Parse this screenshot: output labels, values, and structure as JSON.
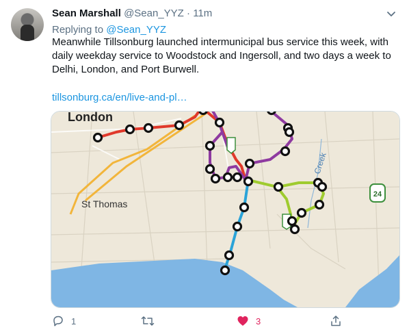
{
  "tweet": {
    "author_name": "Sean Marshall",
    "handle": "@Sean_YYZ",
    "separator": "·",
    "time": "11m",
    "reply_prefix": "Replying to ",
    "reply_handle": "@Sean_YYZ",
    "body": "Meanwhile Tillsonburg launched intermunicipal bus service this week, with daily weekday service to Woodstock and Ingersoll, and two days a week to Delhi, London, and Port Burwell.",
    "link_text": "tillsonburg.ca/en/live-and-pl…"
  },
  "map": {
    "labels": {
      "london": "London",
      "st_thomas": "St Thomas",
      "creek": "Creek",
      "hwy24": "24"
    },
    "route_colors": {
      "red": "#e0392b",
      "purple": "#8e3aa0",
      "blue": "#2aa3d8",
      "green": "#9fcb2f",
      "highway": "#f2b53b",
      "water": "#7fb6e4",
      "land": "#efe9dc"
    }
  },
  "actions": {
    "reply_count": "1",
    "retweet_count": "",
    "like_count": "3",
    "like_liked": true,
    "icons": [
      "reply-icon",
      "retweet-icon",
      "heart-icon",
      "share-icon"
    ]
  }
}
